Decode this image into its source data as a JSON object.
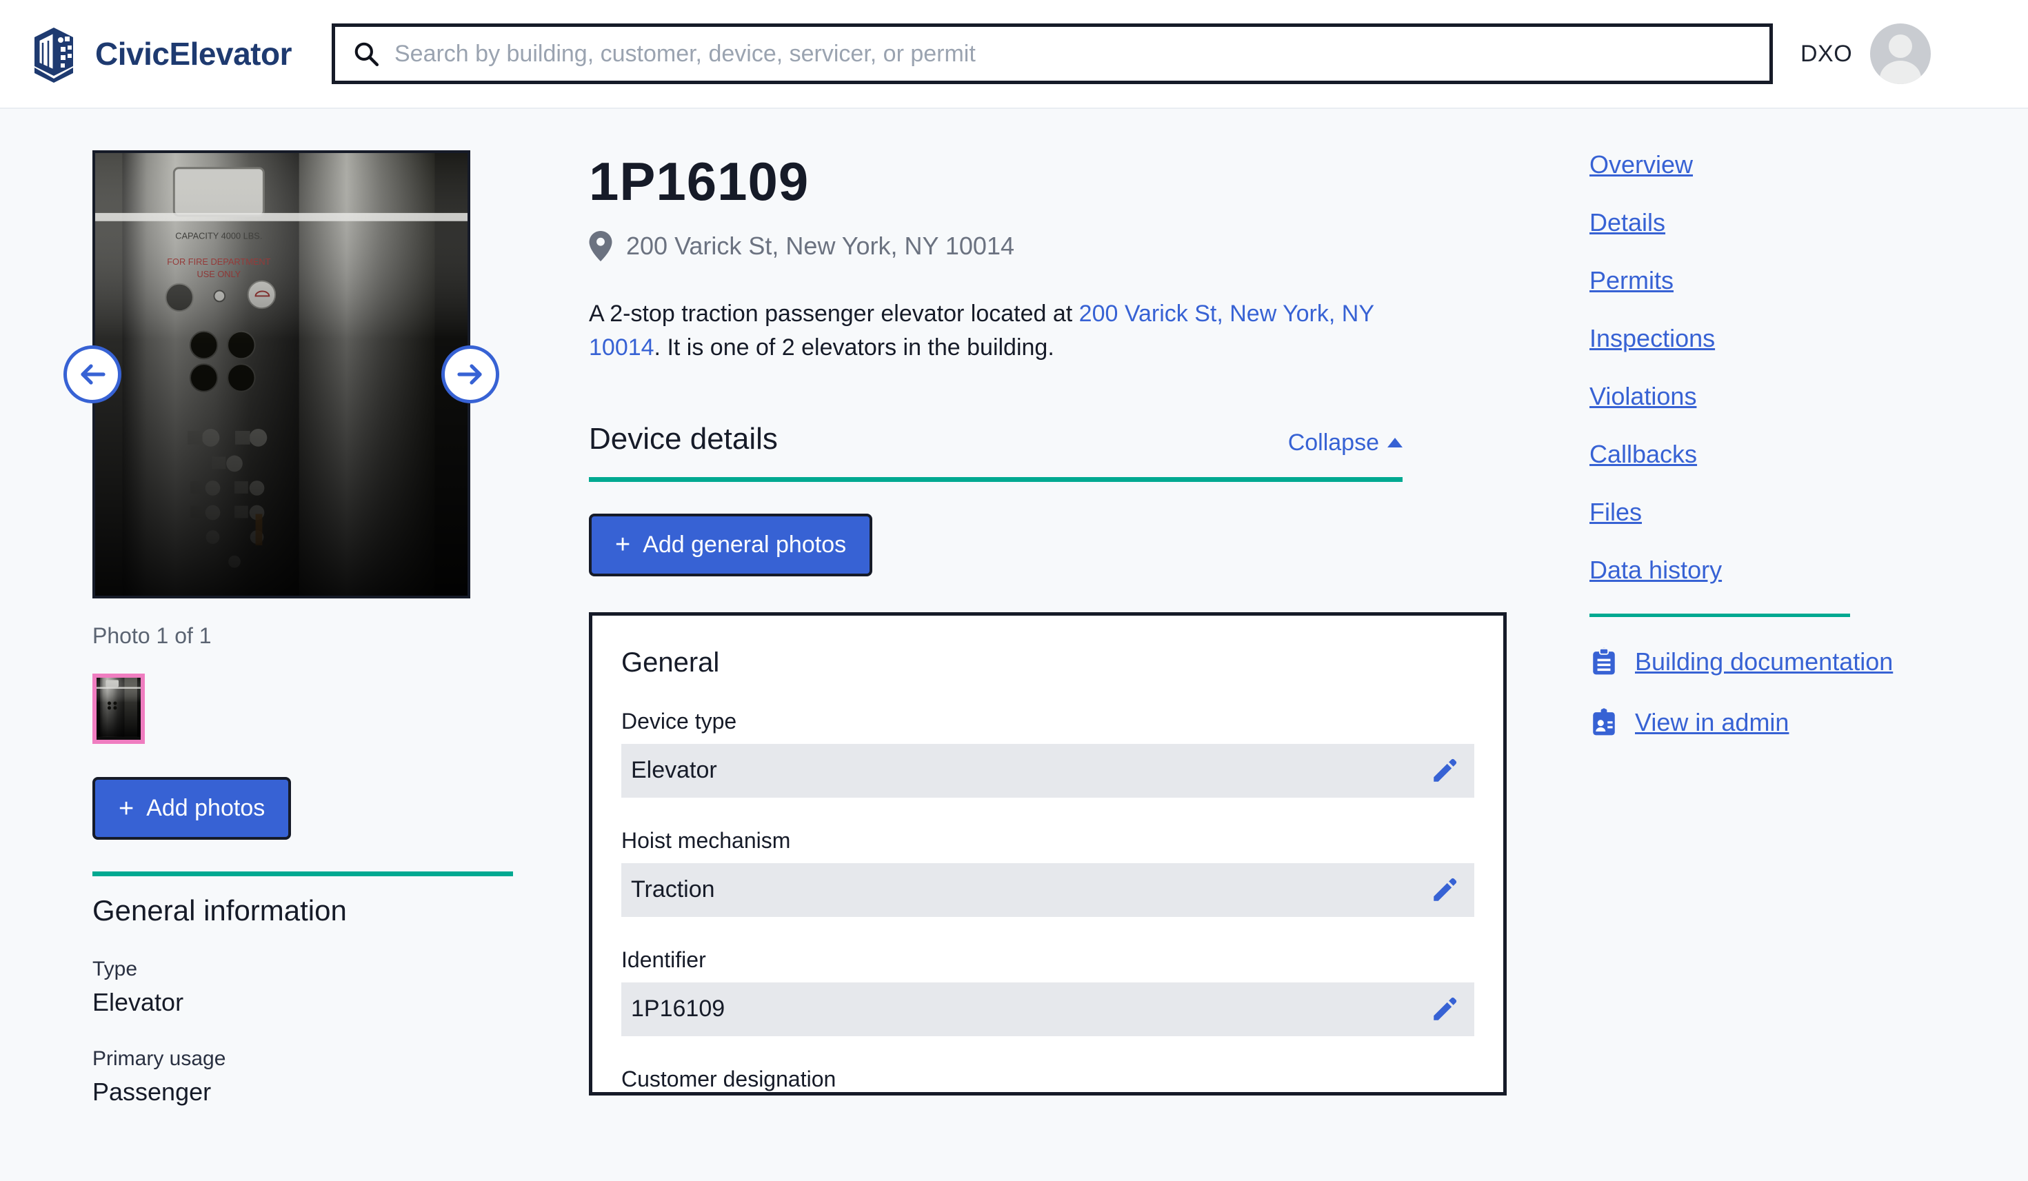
{
  "header": {
    "brand_name": "CivicElevator",
    "logo_icon": "building-cube-icon",
    "search": {
      "icon": "search-icon",
      "placeholder": "Search by building, customer, device, servicer, or permit",
      "value": ""
    },
    "user_initials": "DXO",
    "avatar_icon": "user-avatar-icon"
  },
  "left": {
    "carousel": {
      "prev_icon": "arrow-left-icon",
      "next_icon": "arrow-right-icon",
      "photo_caption": "Photo 1 of 1",
      "photo_alt": "Elevator control panel",
      "photo_overlay_text_1": "CAPACITY 4000 LBS.",
      "photo_overlay_text_2": "FOR FIRE DEPARTMENT",
      "photo_overlay_text_3": "USE ONLY"
    },
    "add_photos_label": "Add photos",
    "add_photos_plus": "+",
    "general_info_title": "General information",
    "fields": [
      {
        "label": "Type",
        "value": "Elevator"
      },
      {
        "label": "Primary usage",
        "value": "Passenger"
      }
    ]
  },
  "main": {
    "device_id": "1P16109",
    "pin_icon": "map-pin-icon",
    "address": "200 Varick St, New York, NY 10014",
    "description": {
      "before_link": "A 2-stop traction passenger elevator located at ",
      "link_text": "200 Varick St, New York, NY 10014",
      "after_link": ". It is one of 2 elevators in the building."
    },
    "device_details": {
      "title": "Device details",
      "collapse_label": "Collapse",
      "collapse_icon": "caret-up-icon"
    },
    "add_general_photos_label": "Add general photos",
    "add_general_photos_plus": "+",
    "general_card": {
      "title": "General",
      "fields": [
        {
          "label": "Device type",
          "value": "Elevator",
          "edit_icon": "pencil-icon"
        },
        {
          "label": "Hoist mechanism",
          "value": "Traction",
          "edit_icon": "pencil-icon"
        },
        {
          "label": "Identifier",
          "value": "1P16109",
          "edit_icon": "pencil-icon"
        }
      ],
      "next_field_label": "Customer designation"
    }
  },
  "right": {
    "nav_links": [
      "Overview",
      "Details",
      "Permits",
      "Inspections",
      "Violations",
      "Callbacks",
      "Files",
      "Data history"
    ],
    "icon_links": [
      {
        "label": "Building documentation",
        "icon": "clipboard-icon"
      },
      {
        "label": "View in admin",
        "icon": "id-badge-icon"
      }
    ]
  },
  "colors": {
    "accent_teal": "#00a991",
    "link_blue": "#3762d4",
    "brand_navy": "#1e3a70",
    "page_bg": "#f7f9fb",
    "thumb_selected": "#ef7dc0"
  }
}
